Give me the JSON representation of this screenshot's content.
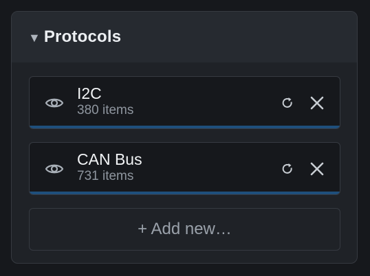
{
  "panel": {
    "caret_icon": "triangle-down-icon",
    "title": "Protocols"
  },
  "items": [
    {
      "name": "I2C",
      "count": "380 items",
      "accent_color": "#1f4f7c"
    },
    {
      "name": "CAN Bus",
      "count": "731 items",
      "accent_color": "#1f4f7c"
    }
  ],
  "add_new_label": "+ Add new…",
  "colors": {
    "background": "#16181c",
    "panel": "#1f2227",
    "header": "#262a30",
    "border": "#363a41",
    "accent": "#1f4f7c"
  }
}
